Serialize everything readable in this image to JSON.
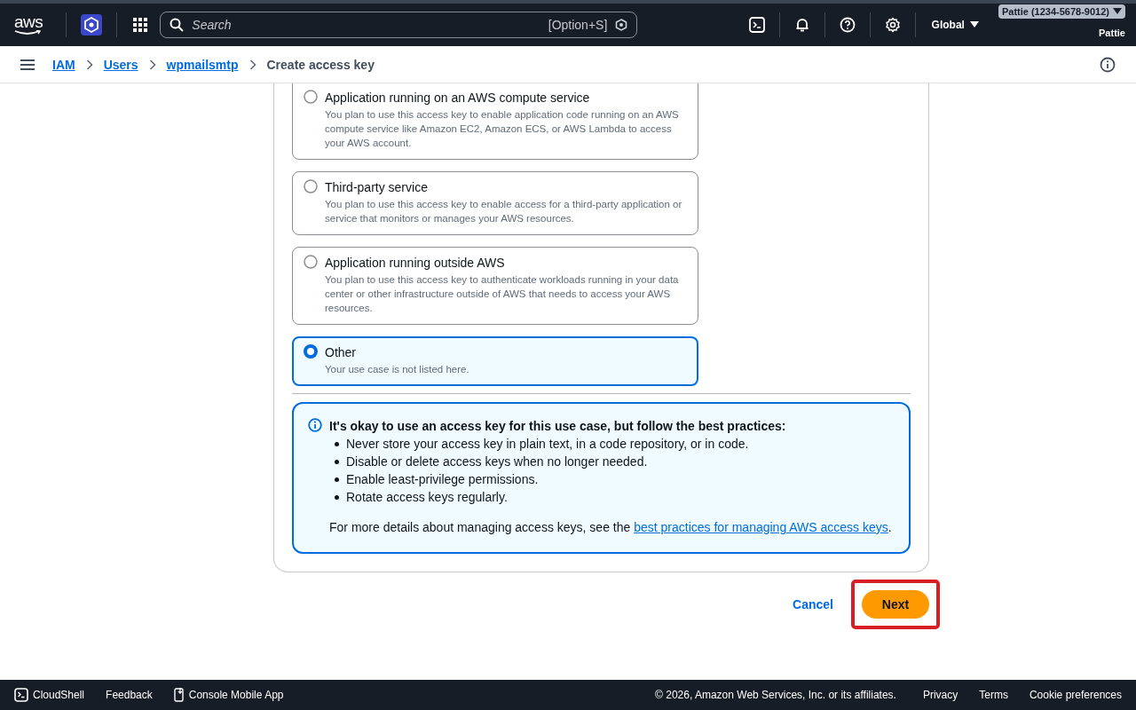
{
  "nav": {
    "logo": "aws",
    "search": {
      "placeholder": "Search",
      "shortcut": "[Option+S]"
    },
    "region": "Global",
    "account": "Pattie (1234-5678-9012)",
    "user": "Pattie"
  },
  "breadcrumbs": [
    {
      "label": "IAM",
      "kind": "link"
    },
    {
      "label": "Users",
      "kind": "link"
    },
    {
      "label": "wpmailsmtp",
      "kind": "link"
    },
    {
      "label": "Create access key",
      "kind": "current"
    }
  ],
  "options": [
    {
      "title": "Application running on an AWS compute service",
      "description": "You plan to use this access key to enable application code running on an AWS compute service like Amazon EC2, Amazon ECS, or AWS Lambda to access your AWS account.",
      "selected": false
    },
    {
      "title": "Third-party service",
      "description": "You plan to use this access key to enable access for a third-party application or service that monitors or manages your AWS resources.",
      "selected": false
    },
    {
      "title": "Application running outside AWS",
      "description": "You plan to use this access key to authenticate workloads running in your data center or other infrastructure outside of AWS that needs to access your AWS resources.",
      "selected": false
    },
    {
      "title": "Other",
      "description": "Your use case is not listed here.",
      "selected": true
    }
  ],
  "alert": {
    "title": "It's okay to use an access key for this use case, but follow the best practices:",
    "bullets": [
      "Never store your access key in plain text, in a code repository, or in code.",
      "Disable or delete access keys when no longer needed.",
      "Enable least-privilege permissions.",
      "Rotate access keys regularly."
    ],
    "text": "For more details about managing access keys, see the",
    "link": "best practices for managing AWS access keys",
    "text_after": "."
  },
  "actions": [
    {
      "label": "Cancel",
      "kind": "link",
      "highlighted": false
    },
    {
      "label": "Next",
      "kind": "primary",
      "highlighted": true
    }
  ],
  "footer": {
    "items": [
      {
        "label": "CloudShell",
        "kind": "cloudshell"
      },
      {
        "label": "Feedback",
        "kind": "plain"
      },
      {
        "label": "Console Mobile App",
        "kind": "mobile"
      }
    ],
    "copyright": "© 2026, Amazon Web Services, Inc. or its affiliates.",
    "links": [
      "Privacy",
      "Terms",
      "Cookie preferences"
    ]
  }
}
